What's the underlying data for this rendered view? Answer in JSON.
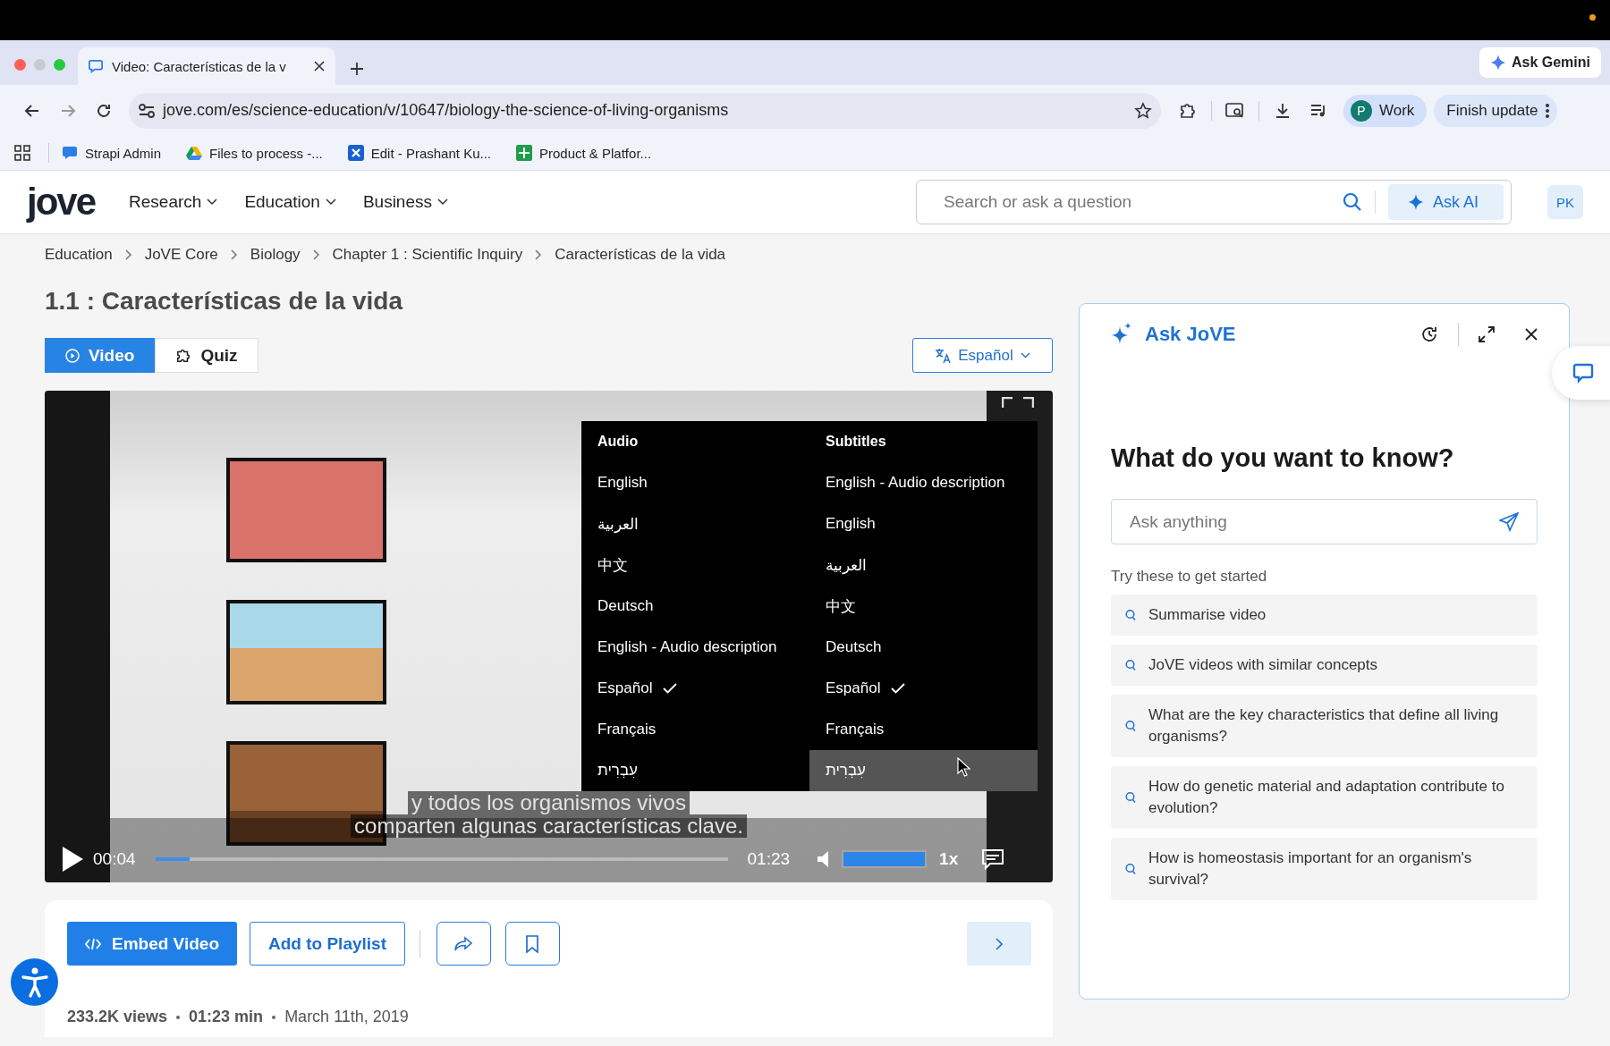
{
  "browser": {
    "tab": {
      "title": "Video: Características de la v"
    },
    "ask_gemini": "Ask Gemini",
    "url": "jove.com/es/science-education/v/10647/biology-the-science-of-living-organisms",
    "profile": {
      "initial": "P",
      "label": "Work"
    },
    "update_button": "Finish update",
    "bookmarks": [
      {
        "label": "Strapi Admin",
        "kind": "chat"
      },
      {
        "label": "Files to process -...",
        "kind": "triangle"
      },
      {
        "label": "Edit - Prashant Ku...",
        "kind": "cross"
      },
      {
        "label": "Product & Platfor...",
        "kind": "sheet"
      }
    ]
  },
  "site": {
    "logo": "jove",
    "nav": [
      "Research",
      "Education",
      "Business"
    ],
    "search": {
      "placeholder": "Search or ask a question"
    },
    "ask_ai": "Ask AI",
    "avatar": "PK"
  },
  "breadcrumbs": [
    "Education",
    "JoVE Core",
    "Biology",
    "Chapter 1 : Scientific Inquiry",
    "Características de la vida"
  ],
  "title": "1.1 : Características de la vida",
  "view_tabs": [
    {
      "label": "Video",
      "kind": "video",
      "selected": true
    },
    {
      "label": "Quiz",
      "kind": "quiz",
      "selected": false
    }
  ],
  "language_button": "Español",
  "player": {
    "menu": [
      {
        "heading": "Audio",
        "items": [
          {
            "label": "English",
            "selected": false,
            "highlighted": false
          },
          {
            "label": "العربية",
            "selected": false,
            "highlighted": false
          },
          {
            "label": "中文",
            "selected": false,
            "highlighted": false
          },
          {
            "label": "Deutsch",
            "selected": false,
            "highlighted": false
          },
          {
            "label": "English - Audio description",
            "selected": false,
            "highlighted": false
          },
          {
            "label": "Español",
            "selected": true,
            "highlighted": false
          },
          {
            "label": "Français",
            "selected": false,
            "highlighted": false
          },
          {
            "label": "עִבְרִית",
            "selected": false,
            "highlighted": false
          }
        ]
      },
      {
        "heading": "Subtitles",
        "items": [
          {
            "label": "English - Audio description",
            "selected": false,
            "highlighted": false
          },
          {
            "label": "English",
            "selected": false,
            "highlighted": false
          },
          {
            "label": "العربية",
            "selected": false,
            "highlighted": false
          },
          {
            "label": "中文",
            "selected": false,
            "highlighted": false
          },
          {
            "label": "Deutsch",
            "selected": false,
            "highlighted": false
          },
          {
            "label": "Español",
            "selected": true,
            "highlighted": false
          },
          {
            "label": "Français",
            "selected": false,
            "highlighted": false
          },
          {
            "label": "עִבְרִית",
            "selected": false,
            "highlighted": true
          }
        ]
      }
    ],
    "subtitle_lines": [
      "y todos los organismos vivos",
      "comparten algunas características clave."
    ],
    "current_time": "00:04",
    "progress": {
      "level": 0.06
    },
    "duration": "01:23",
    "volume": {
      "level": 1
    },
    "speed": "1x"
  },
  "actions": {
    "buttons": [
      {
        "label": "Embed Video",
        "kind": "primary"
      },
      {
        "label": "Add to Playlist",
        "kind": "outline"
      }
    ]
  },
  "meta": {
    "views": "233.2K views",
    "duration": "01:23 min",
    "date": "March 11th, 2019"
  },
  "ask_panel": {
    "title": "Ask JoVE",
    "heading": "What do you want to know?",
    "input": {
      "placeholder": "Ask anything"
    },
    "suggestions_label": "Try these to get started",
    "suggestions": [
      "Summarise video",
      "JoVE videos with similar concepts",
      "What are the key characteristics that define all living organisms?",
      "How do genetic material and adaptation contribute to evolution?",
      "How is homeostasis important for an organism's survival?"
    ]
  }
}
